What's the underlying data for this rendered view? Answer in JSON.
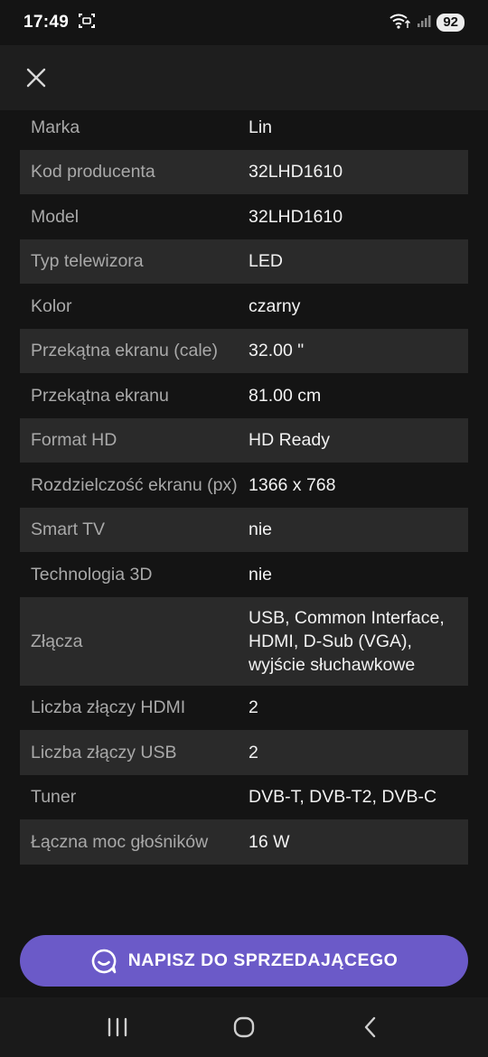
{
  "status_bar": {
    "time": "17:49",
    "battery": "92"
  },
  "header": {
    "close_icon": "close-icon"
  },
  "specs": [
    {
      "label": "Marka",
      "value": "Lin"
    },
    {
      "label": "Kod producenta",
      "value": "32LHD1610"
    },
    {
      "label": "Model",
      "value": "32LHD1610"
    },
    {
      "label": "Typ telewizora",
      "value": "LED"
    },
    {
      "label": "Kolor",
      "value": "czarny"
    },
    {
      "label": "Przekątna ekranu (cale)",
      "value": "32.00 \""
    },
    {
      "label": "Przekątna ekranu",
      "value": "81.00 cm"
    },
    {
      "label": "Format HD",
      "value": "HD Ready"
    },
    {
      "label": "Rozdzielczość ekranu (px)",
      "value": "1366 x 768"
    },
    {
      "label": "Smart TV",
      "value": "nie"
    },
    {
      "label": "Technologia 3D",
      "value": "nie"
    },
    {
      "label": "Złącza",
      "value": "USB, Common Interface, HDMI, D-Sub (VGA), wyjście słuchawkowe"
    },
    {
      "label": "Liczba złączy HDMI",
      "value": "2"
    },
    {
      "label": "Liczba złączy USB",
      "value": "2"
    },
    {
      "label": "Tuner",
      "value": "DVB-T, DVB-T2, DVB-C"
    },
    {
      "label": "Łączna moc głośników",
      "value": "16 W"
    }
  ],
  "cta": {
    "label": "NAPISZ DO SPRZEDAJĄCEGO",
    "icon": "chat-icon"
  },
  "nav": {
    "recents_icon": "recents-icon",
    "home_icon": "home-icon",
    "back_icon": "back-icon"
  },
  "colors": {
    "background": "#141414",
    "row_alt": "#2a2a2a",
    "accent": "#6b5ac8"
  }
}
